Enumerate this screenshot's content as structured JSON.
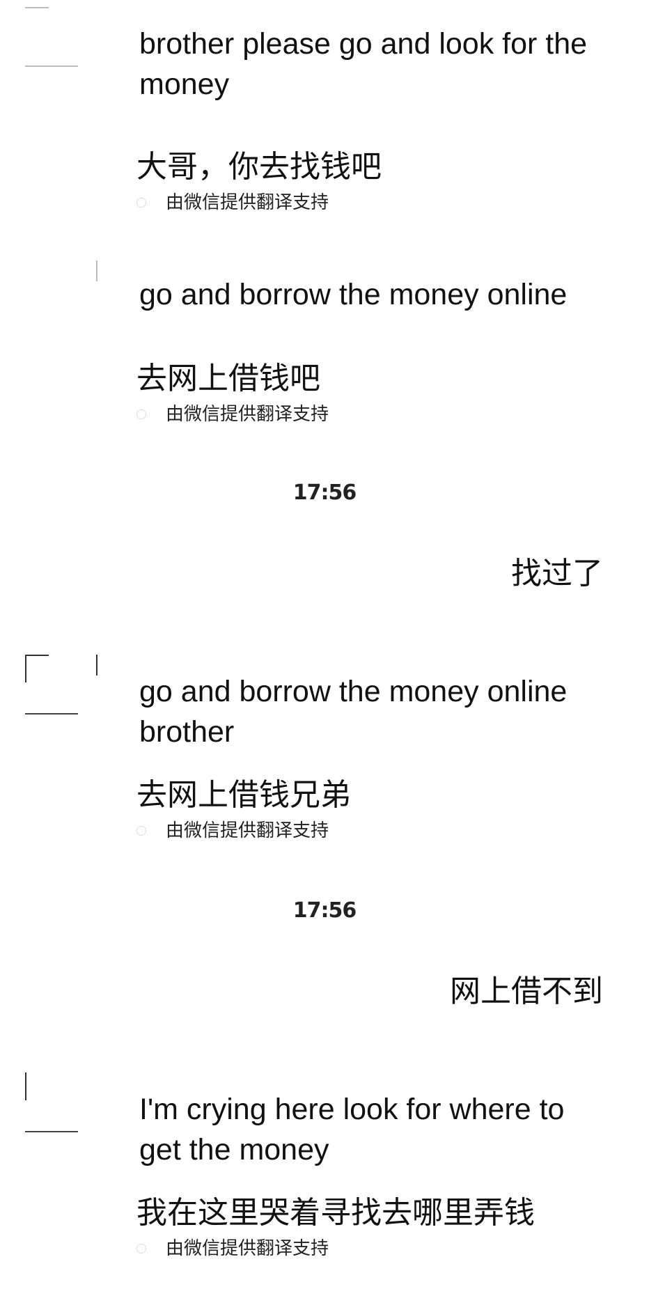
{
  "messages": [
    {
      "direction": "incoming",
      "english": "brother please go and look for the money",
      "chinese": "大哥，你去找钱吧",
      "provider": "由微信提供翻译支持"
    },
    {
      "direction": "incoming",
      "english": "go and borrow the money online",
      "chinese": "去网上借钱吧",
      "provider": "由微信提供翻译支持"
    },
    {
      "direction": "timestamp",
      "text": "17:56"
    },
    {
      "direction": "outgoing",
      "text": "找过了"
    },
    {
      "direction": "incoming",
      "english": "go and borrow the money online brother",
      "chinese": "去网上借钱兄弟",
      "provider": "由微信提供翻译支持"
    },
    {
      "direction": "timestamp",
      "text": "17:56"
    },
    {
      "direction": "outgoing",
      "text": "网上借不到"
    },
    {
      "direction": "incoming",
      "english": "I'm crying here look for where to get the money",
      "chinese": "我在这里哭着寻找去哪里弄钱",
      "provider": "由微信提供翻译支持"
    }
  ]
}
